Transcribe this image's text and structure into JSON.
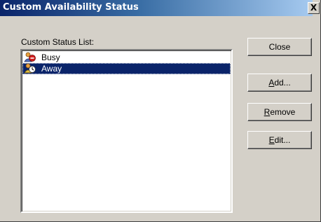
{
  "window": {
    "title": "Custom Availability Status",
    "close_glyph": "X"
  },
  "list": {
    "label": "Custom Status List:",
    "items": [
      {
        "label": "Busy",
        "icon": "busy-status-icon",
        "selected": false
      },
      {
        "label": "Away",
        "icon": "away-status-icon",
        "selected": true
      }
    ]
  },
  "buttons": {
    "close": {
      "text": "Close"
    },
    "add": {
      "accel": "A",
      "rest": "dd..."
    },
    "remove": {
      "accel": "R",
      "rest": "emove"
    },
    "edit": {
      "accel": "E",
      "rest": "dit..."
    }
  },
  "colors": {
    "title_bar": "#0a246a",
    "selection": "#0a246a",
    "face": "#d4d0c8"
  }
}
